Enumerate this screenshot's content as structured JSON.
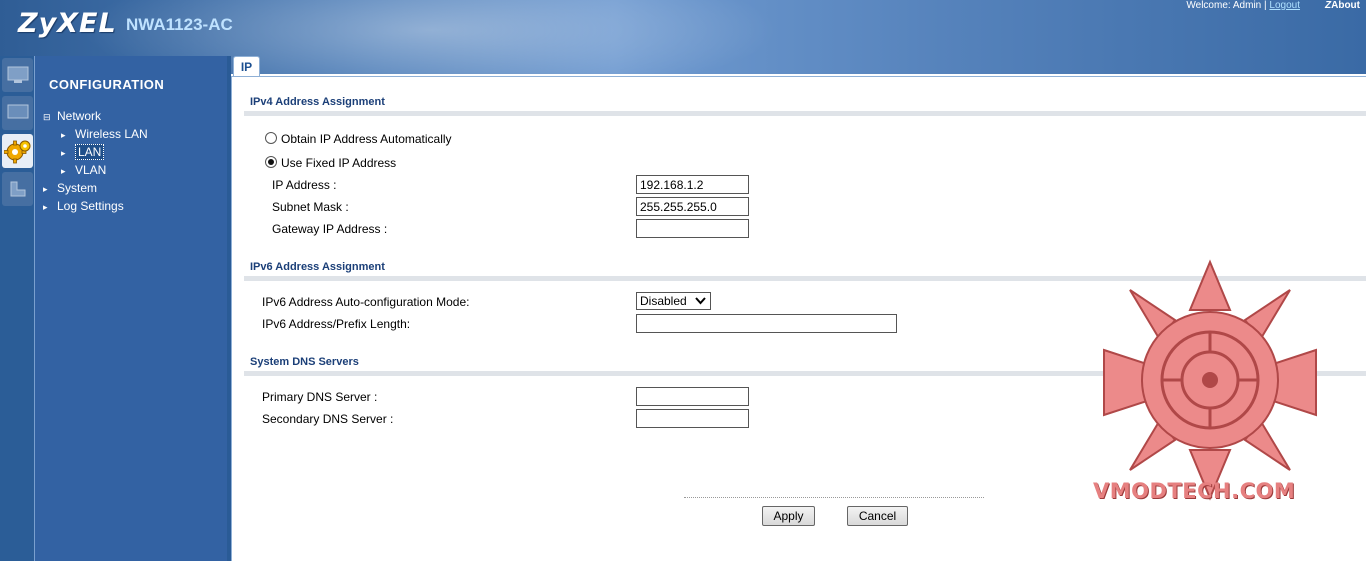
{
  "header": {
    "logo": "ZyXEL",
    "model": "NWA1123-AC",
    "welcome_text": "Welcome: Admin |",
    "logout_label": "Logout",
    "about_label": "About"
  },
  "sidebar": {
    "title": "CONFIGURATION",
    "items": [
      {
        "label": "Network",
        "marker": "⊟"
      },
      {
        "label": "Wireless LAN",
        "marker": "▸"
      },
      {
        "label": "LAN",
        "marker": "▸"
      },
      {
        "label": "VLAN",
        "marker": "▸"
      },
      {
        "label": "System",
        "marker": "▸"
      },
      {
        "label": "Log Settings",
        "marker": "▸"
      }
    ]
  },
  "tabs": {
    "ip": "IP"
  },
  "ipv4": {
    "title": "IPv4 Address Assignment",
    "obtain_auto_label": "Obtain IP Address Automatically",
    "use_fixed_label": "Use Fixed IP Address",
    "selected": "fixed",
    "ip_label": "IP Address :",
    "ip_value": "192.168.1.2",
    "subnet_label": "Subnet Mask :",
    "subnet_value": "255.255.255.0",
    "gateway_label": "Gateway IP Address :",
    "gateway_value": ""
  },
  "ipv6": {
    "title": "IPv6 Address Assignment",
    "mode_label": "IPv6 Address Auto-configuration Mode:",
    "mode_value": "Disabled",
    "prefix_label": "IPv6 Address/Prefix Length:",
    "prefix_value": ""
  },
  "dns": {
    "title": "System DNS Servers",
    "primary_label": "Primary DNS Server :",
    "primary_value": "",
    "secondary_label": "Secondary DNS Server :",
    "secondary_value": ""
  },
  "buttons": {
    "apply": "Apply",
    "cancel": "Cancel"
  },
  "watermark": {
    "text": "VMODTECH.COM"
  },
  "colors": {
    "sidebar": "#3362a3",
    "header": "#4c7cb6",
    "section_title": "#1b3f78",
    "watermark": "#e68080"
  }
}
